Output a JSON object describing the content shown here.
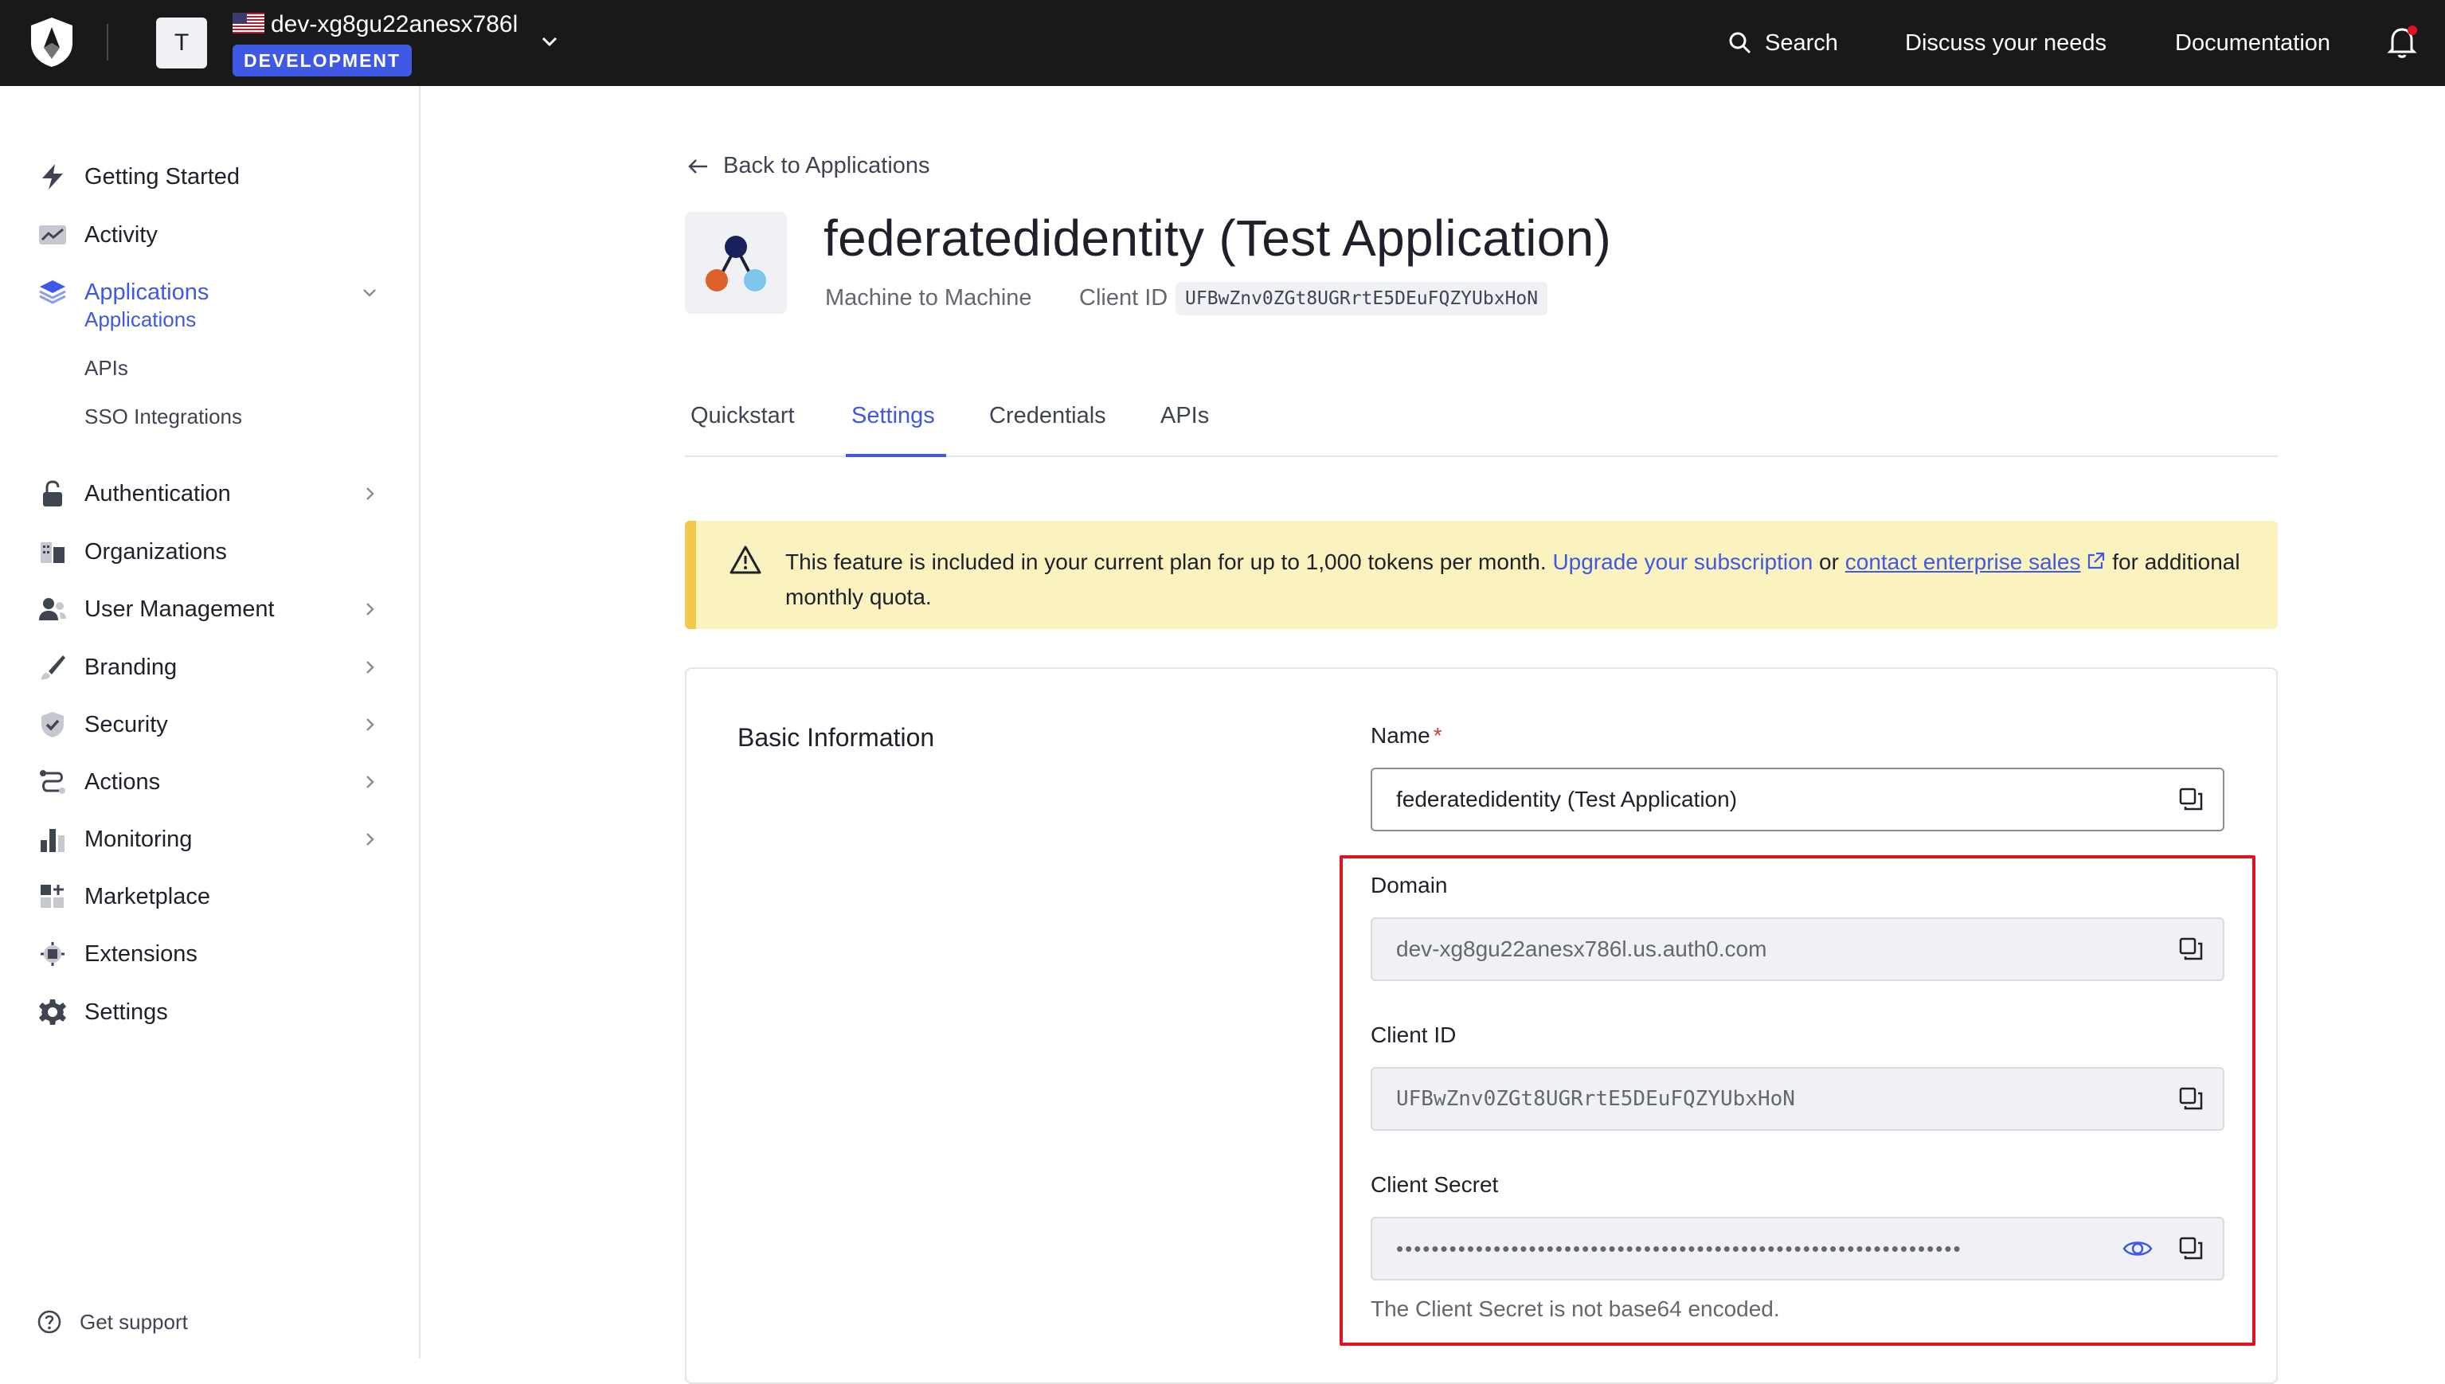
{
  "topbar": {
    "tenant_initial": "T",
    "tenant_name": "dev-xg8gu22anesx786l",
    "environment_badge": "DEVELOPMENT",
    "search_label": "Search",
    "discuss_label": "Discuss your needs",
    "docs_label": "Documentation",
    "colors": {
      "background": "#191919",
      "badge": "#3f59e4",
      "notification_dot": "#e0141e"
    }
  },
  "sidebar": {
    "items": [
      {
        "label": "Getting Started",
        "icon": "bolt-icon"
      },
      {
        "label": "Activity",
        "icon": "activity-chart-icon"
      },
      {
        "label": "Applications",
        "icon": "layers-icon",
        "expanded": true,
        "active": true
      },
      {
        "label": "Authentication",
        "icon": "lock-icon",
        "has_children": true
      },
      {
        "label": "Organizations",
        "icon": "building-icon"
      },
      {
        "label": "User Management",
        "icon": "users-icon",
        "has_children": true
      },
      {
        "label": "Branding",
        "icon": "brush-icon",
        "has_children": true
      },
      {
        "label": "Security",
        "icon": "shield-check-icon",
        "has_children": true
      },
      {
        "label": "Actions",
        "icon": "flow-icon",
        "has_children": true
      },
      {
        "label": "Monitoring",
        "icon": "bar-chart-icon",
        "has_children": true
      },
      {
        "label": "Marketplace",
        "icon": "grid-plus-icon"
      },
      {
        "label": "Extensions",
        "icon": "puzzle-icon"
      },
      {
        "label": "Settings",
        "icon": "gear-icon"
      }
    ],
    "sub_items": [
      {
        "label": "Applications",
        "active": true
      },
      {
        "label": "APIs"
      },
      {
        "label": "SSO Integrations"
      }
    ],
    "support_label": "Get support"
  },
  "main": {
    "back_label": "Back to Applications",
    "app_title": "federatedidentity (Test Application)",
    "app_type": "Machine to Machine",
    "client_id_label": "Client ID",
    "client_id_value": "UFBwZnv0ZGt8UGRrtE5DEuFQZYUbxHoN",
    "tabs": [
      "Quickstart",
      "Settings",
      "Credentials",
      "APIs"
    ],
    "active_tab": "Settings",
    "notice": {
      "text_before": "This feature is included in your current plan for up to 1,000 tokens per month. ",
      "upgrade_link": "Upgrade your subscription",
      "or": " or ",
      "sales_link": "contact enterprise sales",
      "text_after": " for additional monthly quota."
    },
    "basic_info": {
      "section_title": "Basic Information",
      "name_label": "Name",
      "name_required_mark": "*",
      "name_value": "federatedidentity (Test Application)",
      "domain_label": "Domain",
      "domain_value": "dev-xg8gu22anesx786l.us.auth0.com",
      "client_id_label": "Client ID",
      "client_id_value": "UFBwZnv0ZGt8UGRrtE5DEuFQZYUbxHoN",
      "client_secret_label": "Client Secret",
      "client_secret_masked": "••••••••••••••••••••••••••••••••••••••••••••••••••••••••••••••••",
      "client_secret_helper": "The Client Secret is not base64 encoded."
    },
    "colors": {
      "accent": "#3f59e4",
      "notice_bg": "#fbf3bf",
      "notice_border": "#f2c94c",
      "highlight": "#e0141e"
    }
  }
}
